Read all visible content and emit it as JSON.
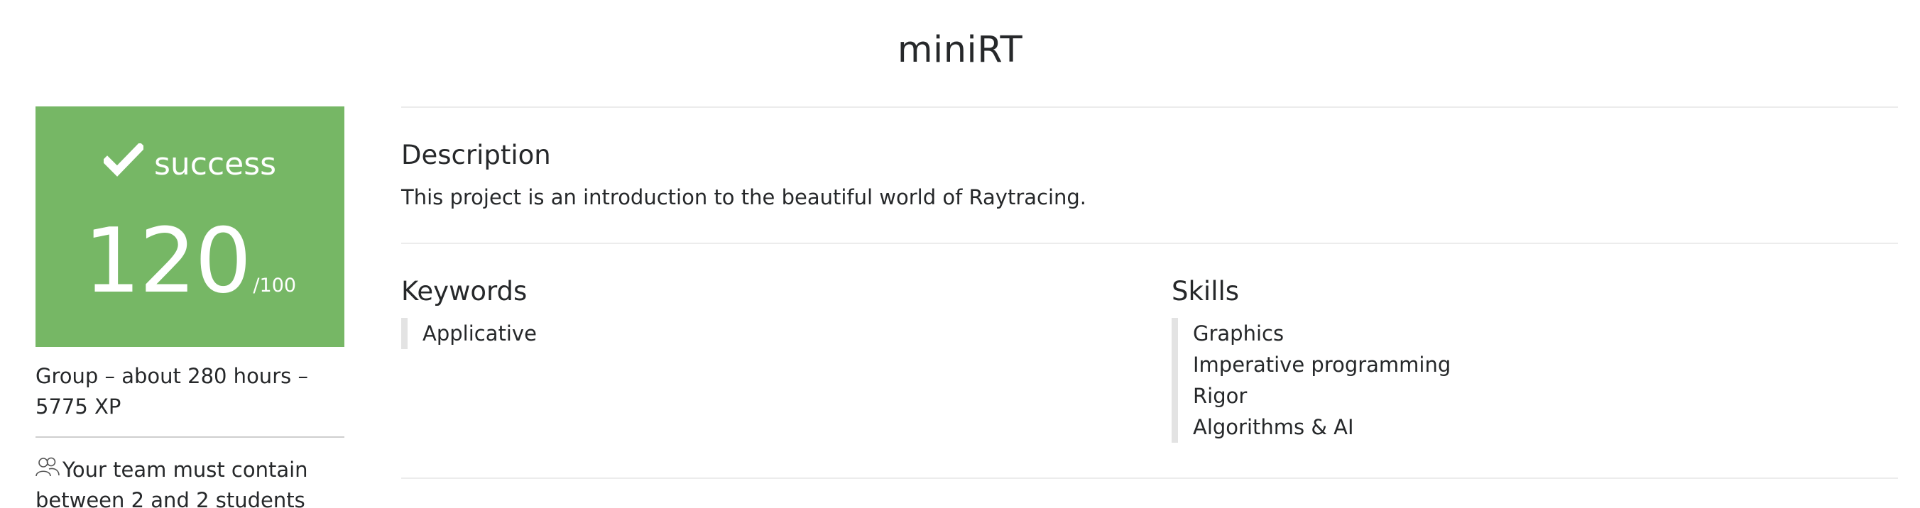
{
  "project": {
    "title": "miniRT"
  },
  "result": {
    "status": "success",
    "score": "120",
    "max": "/100",
    "color": "#76b765",
    "icon": "check-icon"
  },
  "meta": {
    "summary": "Group – about 280 hours – 5775 XP",
    "team_icon": "group-icon",
    "team_rule": "Your team must contain between 2 and 2 students"
  },
  "description": {
    "heading": "Description",
    "text": "This project is an introduction to the beautiful world of Raytracing."
  },
  "keywords": {
    "heading": "Keywords",
    "items": [
      "Applicative"
    ]
  },
  "skills": {
    "heading": "Skills",
    "items": [
      "Graphics",
      "Imperative programming",
      "Rigor",
      "Algorithms & AI"
    ]
  }
}
